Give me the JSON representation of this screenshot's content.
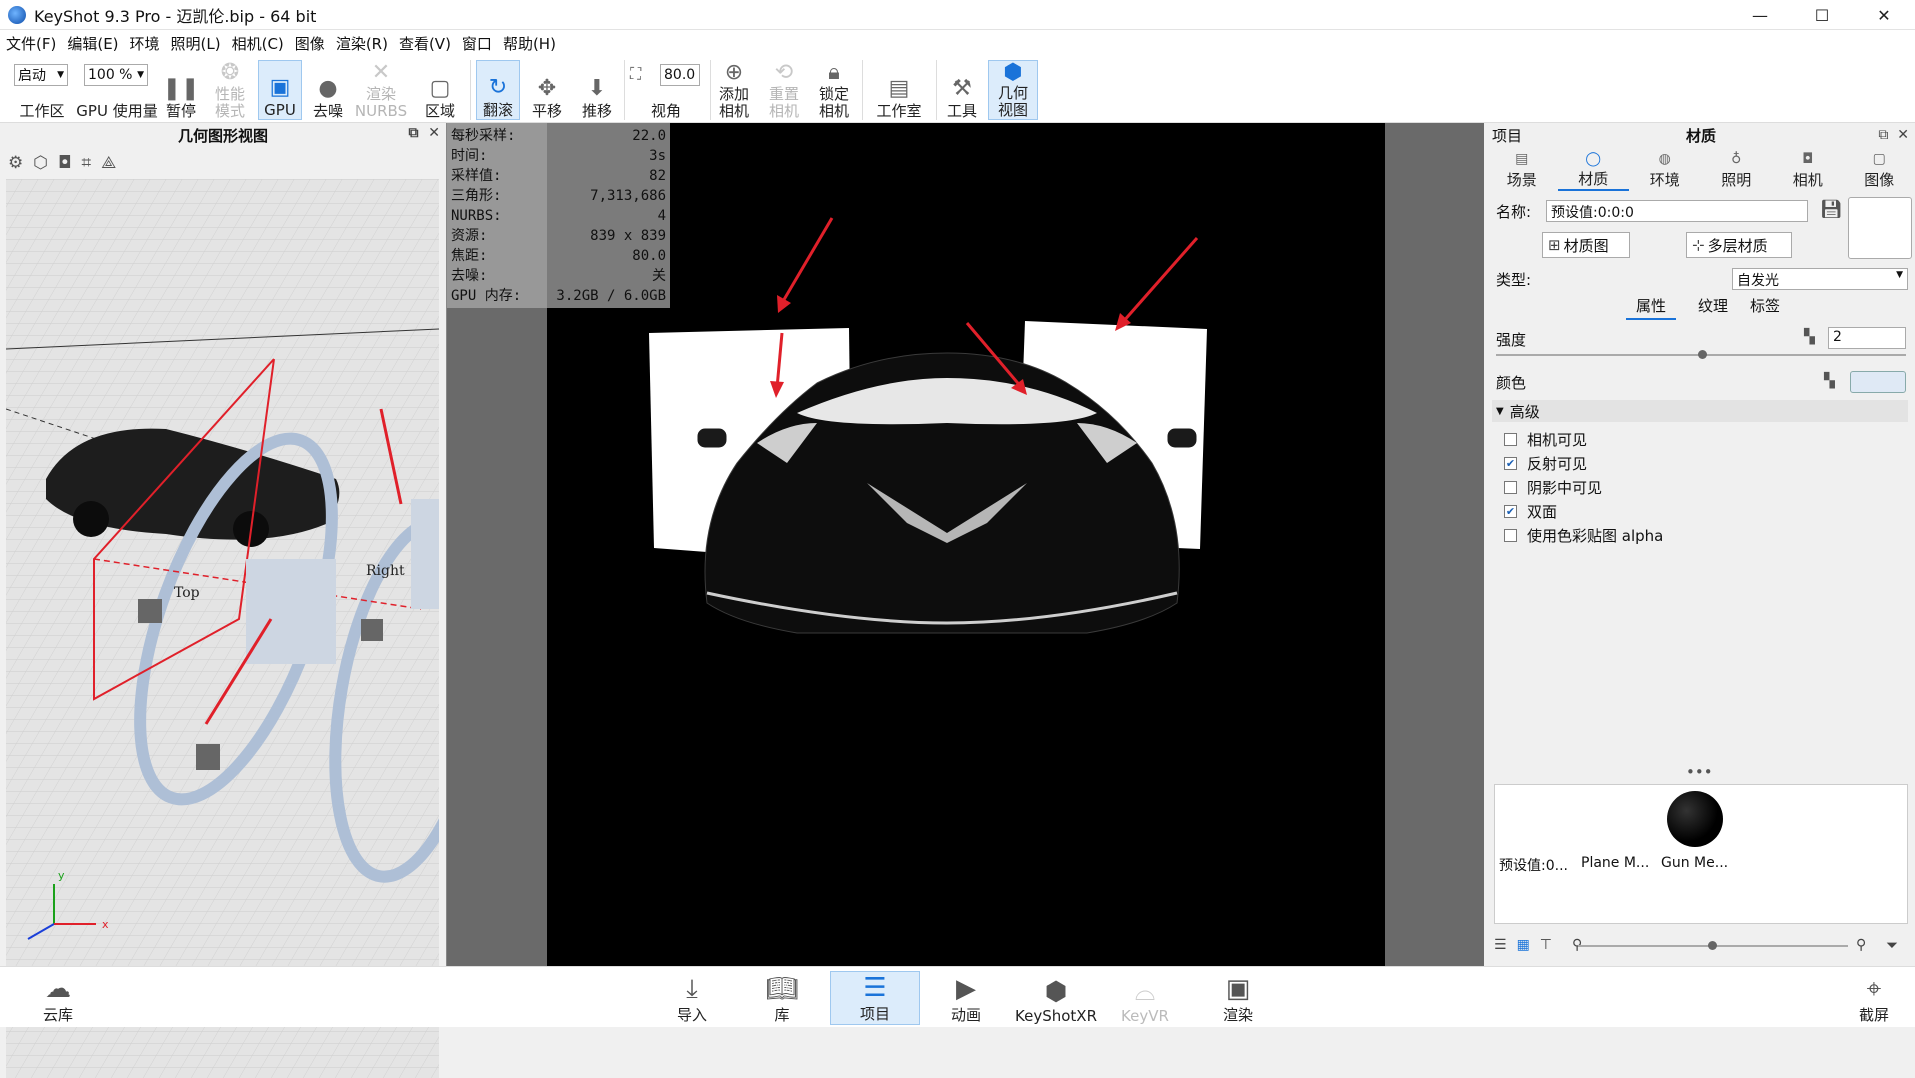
{
  "window": {
    "title": "KeyShot 9.3 Pro  - 迈凯伦.bip  - 64 bit",
    "minimize": "—",
    "maximize": "☐",
    "close": "✕"
  },
  "menu": [
    "文件(F)",
    "编辑(E)",
    "环境",
    "照明(L)",
    "相机(C)",
    "图像",
    "渲染(R)",
    "查看(V)",
    "窗口",
    "帮助(H)"
  ],
  "toolbar": {
    "workspace_select": "启动",
    "workspace_label": "工作区",
    "gpu_usage_select": "100 %",
    "gpu_usage_label": "GPU 使用量",
    "pause": "暂停",
    "perf_mode": "性能\n模式",
    "gpu": "GPU",
    "denoise": "去噪",
    "render_nurbs": "渲染\nNURBS",
    "region": "区域",
    "tumble": "翻滚",
    "pan": "平移",
    "dolly": "推移",
    "fov_value": "80.0",
    "fov_label": "视角",
    "add_camera": "添加\n相机",
    "reset_camera": "重置\n相机",
    "lock_camera": "锁定\n相机",
    "studio": "工作室",
    "tools": "工具",
    "geometry_view": "几何\n视图"
  },
  "geometry_panel": {
    "title": "几何图形视图",
    "label_top": "Top",
    "label_right": "Right",
    "axis_x": "x",
    "axis_y": "y"
  },
  "stats": [
    {
      "label": "每秒采样:",
      "value": "22.0"
    },
    {
      "label": "时间:",
      "value": "3s"
    },
    {
      "label": "采样值:",
      "value": "82"
    },
    {
      "label": "三角形:",
      "value": "7,313,686"
    },
    {
      "label": "NURBS:",
      "value": "4"
    },
    {
      "label": "资源:",
      "value": "839 x 839"
    },
    {
      "label": "焦距:",
      "value": "80.0"
    },
    {
      "label": "去噪:",
      "value": "关"
    },
    {
      "label": "GPU 内存:",
      "value": "3.2GB / 6.0GB"
    }
  ],
  "right_panel": {
    "project_label": "项目",
    "title": "材质",
    "tabs": [
      "场景",
      "材质",
      "环境",
      "照明",
      "相机",
      "图像"
    ],
    "name_label": "名称:",
    "name_value": "预设值:0:0:0",
    "material_graph": "材质图",
    "multi_material": "多层材质",
    "type_label": "类型:",
    "type_value": "自发光",
    "subtabs": [
      "属性",
      "纹理",
      "标签"
    ],
    "intensity_label": "强度",
    "intensity_value": "2",
    "color_label": "颜色",
    "advanced_label": "高级",
    "checkboxes": [
      {
        "label": "相机可见",
        "checked": false
      },
      {
        "label": "反射可见",
        "checked": true
      },
      {
        "label": "阴影中可见",
        "checked": false
      },
      {
        "label": "双面",
        "checked": true
      },
      {
        "label": "使用色彩贴图 alpha",
        "checked": false
      }
    ],
    "materials": [
      "预设值:0...",
      "Plane M...",
      "Gun Me..."
    ],
    "more": "•••"
  },
  "bottom": {
    "cloud": "云库",
    "import": "导入",
    "library": "库",
    "project": "项目",
    "animation": "动画",
    "keyshotxr": "KeyShotXR",
    "keyvr": "KeyVR",
    "render": "渲染",
    "screenshot": "截屏"
  },
  "colors": {
    "accent": "#1a73d9",
    "annotation_arrow": "#e0202a",
    "viewport_bg": "#000000"
  }
}
